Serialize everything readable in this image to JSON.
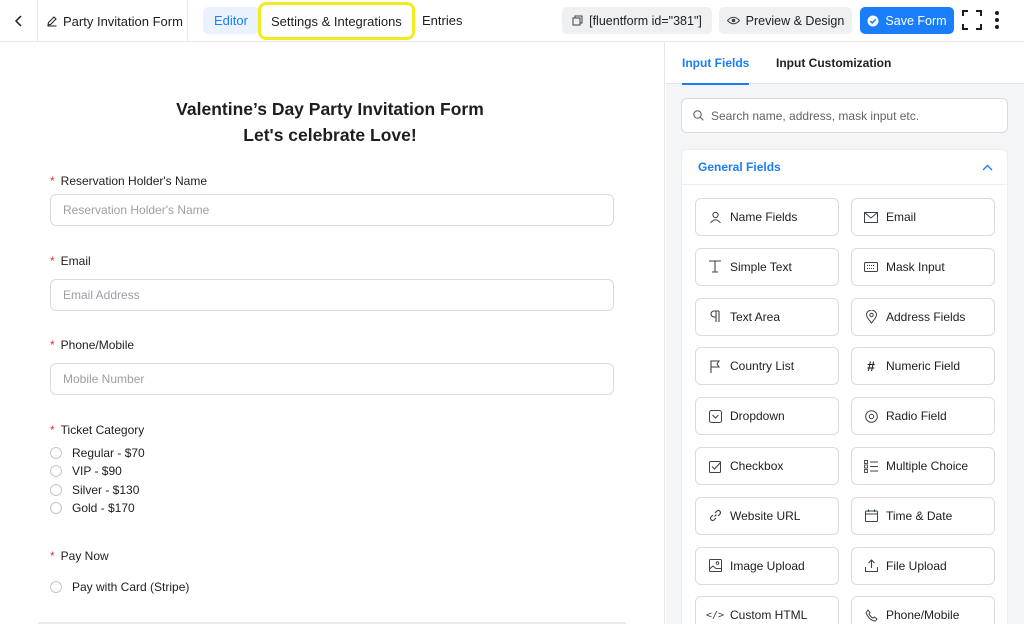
{
  "topbar": {
    "form_title": "Party Invitation Form",
    "tabs": [
      {
        "label": "Editor",
        "active": true
      },
      {
        "label": "Settings & Integrations",
        "highlighted": true
      },
      {
        "label": "Entries"
      }
    ],
    "shortcode": "[fluentform id=\"381\"]",
    "preview_label": "Preview & Design",
    "save_label": "Save Form",
    "accent": "#1a7efb",
    "highlight_color": "#f2ec1e"
  },
  "form": {
    "title_line1": "Valentine’s Day Party Invitation Form",
    "title_line2": "Let's celebrate Love!",
    "required_mark": "*",
    "name_label": "Reservation Holder's Name",
    "name_placeholder": "Reservation Holder's Name",
    "email_label": "Email",
    "email_placeholder": "Email Address",
    "phone_label": "Phone/Mobile",
    "phone_placeholder": "Mobile Number",
    "ticket_label": "Ticket Category",
    "ticket_options": [
      "Regular - $70",
      "VIP - $90",
      "Silver - $130",
      "Gold - $170"
    ],
    "pay_label": "Pay Now",
    "pay_options": [
      "Pay with Card (Stripe)"
    ]
  },
  "panel": {
    "tabs": [
      {
        "label": "Input Fields",
        "active": true
      },
      {
        "label": "Input Customization"
      }
    ],
    "search_placeholder": "Search name, address, mask input etc.",
    "section_title": "General Fields",
    "fields": [
      {
        "label": "Name Fields",
        "icon": "person-icon"
      },
      {
        "label": "Email",
        "icon": "envelope-icon"
      },
      {
        "label": "Simple Text",
        "icon": "text-cursor-icon"
      },
      {
        "label": "Mask Input",
        "icon": "keyboard-icon"
      },
      {
        "label": "Text Area",
        "icon": "paragraph-icon"
      },
      {
        "label": "Address Fields",
        "icon": "map-pin-icon"
      },
      {
        "label": "Country List",
        "icon": "flag-icon"
      },
      {
        "label": "Numeric Field",
        "icon": "hash-icon"
      },
      {
        "label": "Dropdown",
        "icon": "dropdown-icon"
      },
      {
        "label": "Radio Field",
        "icon": "radio-icon"
      },
      {
        "label": "Checkbox",
        "icon": "checkbox-icon"
      },
      {
        "label": "Multiple Choice",
        "icon": "list-icon"
      },
      {
        "label": "Website URL",
        "icon": "link-icon"
      },
      {
        "label": "Time & Date",
        "icon": "calendar-icon"
      },
      {
        "label": "Image Upload",
        "icon": "image-icon"
      },
      {
        "label": "File Upload",
        "icon": "upload-icon"
      },
      {
        "label": "Custom HTML",
        "icon": "code-icon"
      },
      {
        "label": "Phone/Mobile",
        "icon": "phone-icon"
      }
    ]
  }
}
